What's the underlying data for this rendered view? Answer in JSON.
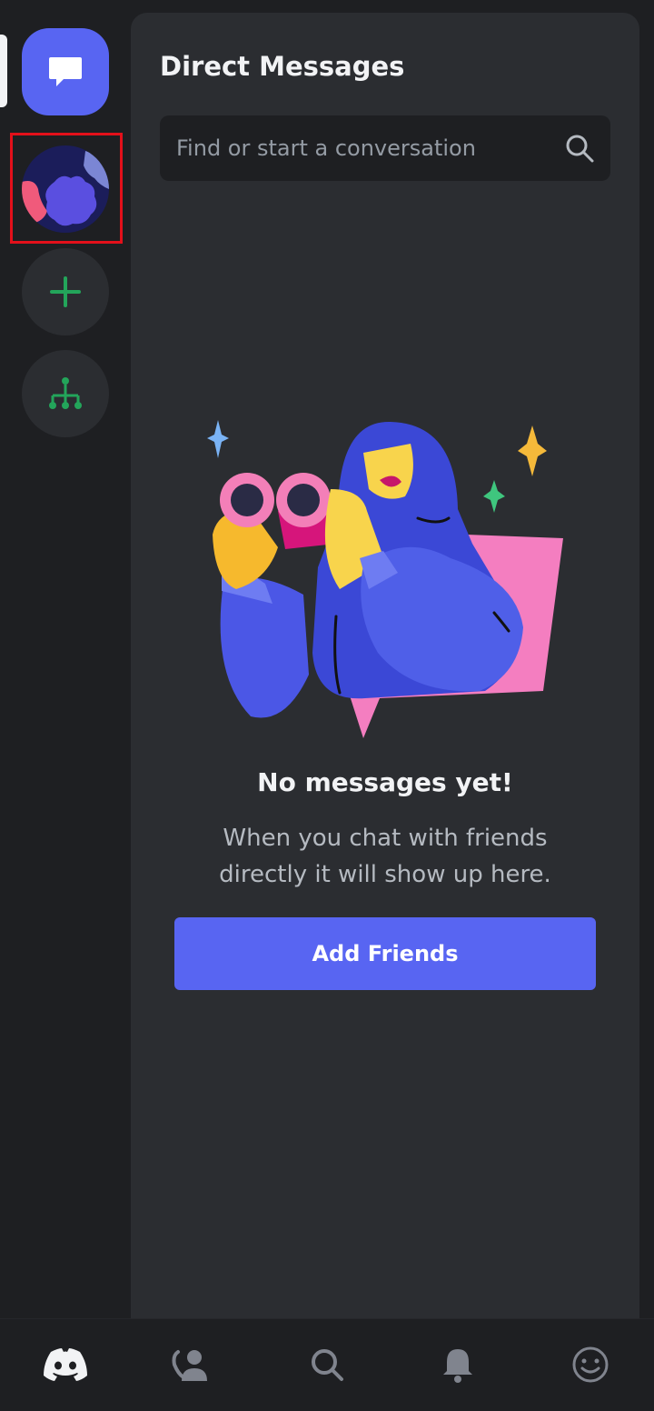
{
  "app": {
    "accent": "#5865f2"
  },
  "sidebar": {
    "items": [
      {
        "name": "direct-messages",
        "icon": "chat-bubble-icon",
        "selected": true
      },
      {
        "name": "server",
        "icon": "server-avatar",
        "highlighted": true
      },
      {
        "name": "add-server",
        "icon": "plus-icon"
      },
      {
        "name": "discover",
        "icon": "hierarchy-icon"
      }
    ]
  },
  "main": {
    "title": "Direct Messages",
    "search": {
      "placeholder": "Find or start a conversation",
      "value": ""
    },
    "empty_state": {
      "title": "No messages yet!",
      "subtitle": "When you chat with friends directly it will show up here.",
      "button": "Add Friends"
    }
  },
  "tabbar": {
    "tabs": [
      {
        "name": "home",
        "icon": "discord-logo-icon",
        "active": true
      },
      {
        "name": "friends",
        "icon": "friends-icon"
      },
      {
        "name": "search",
        "icon": "search-icon"
      },
      {
        "name": "notifications",
        "icon": "bell-icon"
      },
      {
        "name": "profile",
        "icon": "smiley-icon"
      }
    ]
  }
}
